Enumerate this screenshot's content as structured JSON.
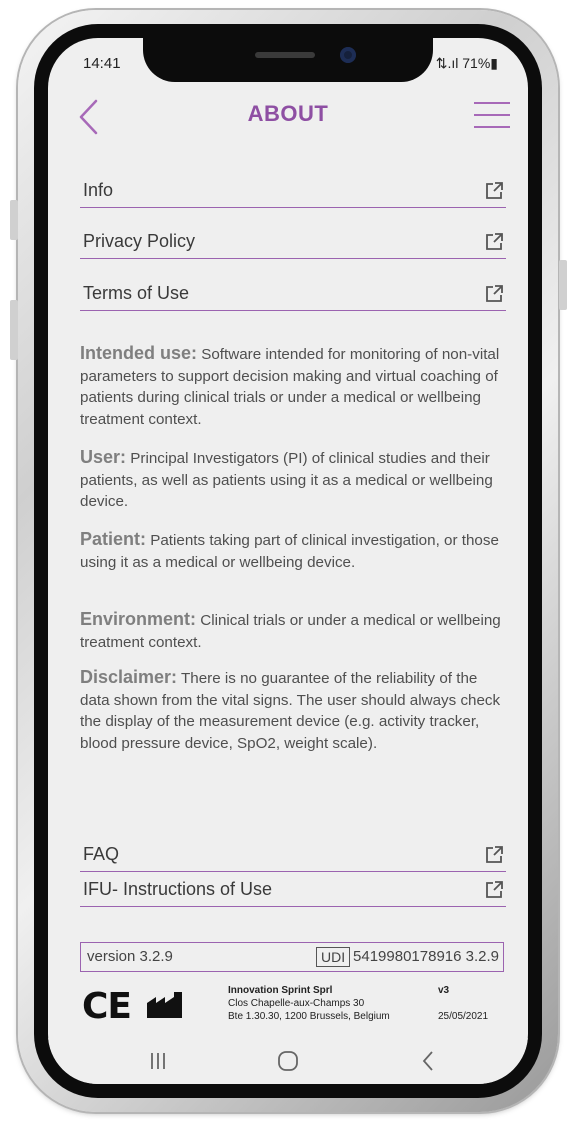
{
  "status_bar": {
    "time": "14:41",
    "indicators": "⇅.ıl 71%▮"
  },
  "header": {
    "title": "ABOUT",
    "back_icon": "chevron-left-icon",
    "menu_icon": "hamburger-menu-icon",
    "accent": "#8e4fa3"
  },
  "top_links": [
    {
      "label": "Info",
      "icon": "external-link-icon"
    },
    {
      "label": "Privacy Policy",
      "icon": "external-link-icon"
    },
    {
      "label": "Terms of Use",
      "icon": "external-link-icon"
    }
  ],
  "info": [
    {
      "heading": "Intended use:",
      "text": " Software intended for monitoring of non-vital parameters to support decision making and virtual coaching of patients during clinical trials or under a medical or wellbeing treatment context."
    },
    {
      "heading": "User:",
      "text": " Principal Investigators (PI) of clinical studies and their patients, as well as patients using it as a medical or wellbeing device."
    },
    {
      "heading": "Patient:",
      "text": " Patients taking part of clinical investigation, or those using it as a medical or wellbeing device."
    },
    {
      "heading": "Environment:",
      "text": "  Clinical trials or under a medical or wellbeing treatment context."
    },
    {
      "heading": "Disclaimer:",
      "text": " There is no guarantee of the reliability of the data shown from the vital signs. The user should always check the display of the measurement device (e.g. activity tracker, blood pressure device, SpO2, weight scale)."
    }
  ],
  "bottom_links": [
    {
      "label": "FAQ",
      "icon": "external-link-icon"
    },
    {
      "label": "IFU- Instructions of Use",
      "icon": "external-link-icon"
    }
  ],
  "version": {
    "text": "version 3.2.9",
    "udi_label": "UDI",
    "udi_value": "5419980178916 3.2.9"
  },
  "manufacturer": {
    "ce_mark": "CE",
    "factory_icon": "manufacturer-factory-icon",
    "name": "Innovation Sprint Sprl",
    "address1": "Clos Chapelle-aux-Champs 30",
    "address2": "Bte 1.30.30, 1200 Brussels, Belgium",
    "doc_version": "v3",
    "date": "25/05/2021"
  },
  "nav_bar": {
    "recents": "recents-icon",
    "home": "home-icon",
    "back": "back-nav-icon"
  }
}
